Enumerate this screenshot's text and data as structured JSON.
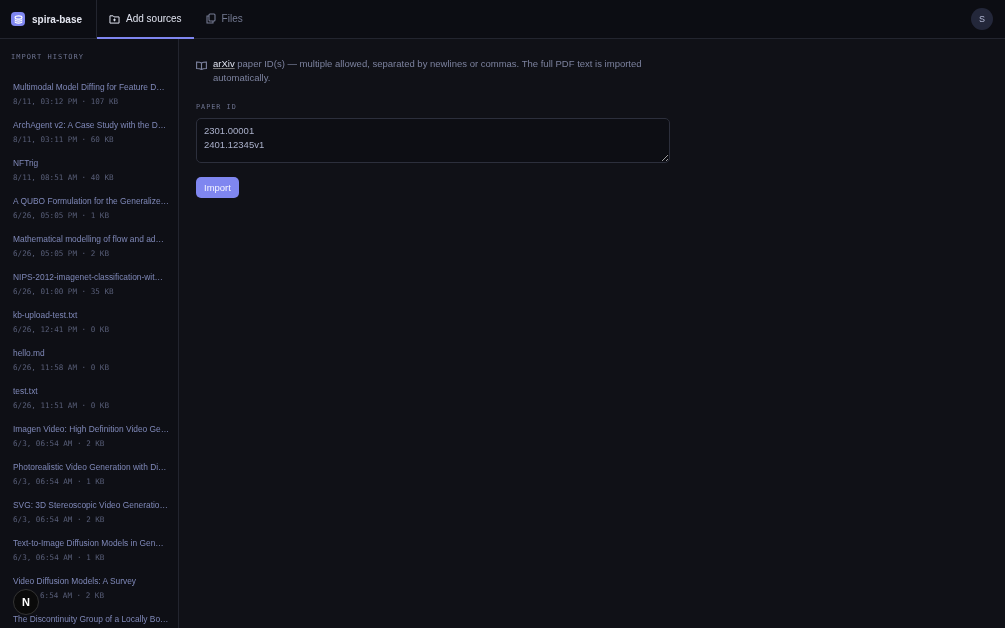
{
  "app": {
    "name": "spira-base",
    "avatar": "S"
  },
  "tabs": [
    {
      "label": "Add sources",
      "selected": true
    },
    {
      "label": "Files",
      "selected": false
    }
  ],
  "sidebar": {
    "heading": "IMPORT HISTORY",
    "items": [
      {
        "title": "Multimodal Model Diffing for Feature D…",
        "meta": "8/11, 03:12 PM · 107 KB"
      },
      {
        "title": "ArchAgent v2: A Case Study with the D…",
        "meta": "8/11, 03:11 PM · 60 KB"
      },
      {
        "title": "NFTrig",
        "meta": "8/11, 08:51 AM · 40 KB"
      },
      {
        "title": "A QUBO Formulation for the Generalize…",
        "meta": "6/26, 05:05 PM · 1 KB"
      },
      {
        "title": "Mathematical modelling of flow and ad…",
        "meta": "6/26, 05:05 PM · 2 KB"
      },
      {
        "title": "NIPS-2012-imagenet-classification-wit…",
        "meta": "6/26, 01:00 PM · 35 KB"
      },
      {
        "title": "kb-upload-test.txt",
        "meta": "6/26, 12:41 PM · 0 KB"
      },
      {
        "title": "hello.md",
        "meta": "6/26, 11:58 AM · 0 KB"
      },
      {
        "title": "test.txt",
        "meta": "6/26, 11:51 AM · 0 KB"
      },
      {
        "title": "Imagen Video: High Definition Video Ge…",
        "meta": "6/3, 06:54 AM · 2 KB"
      },
      {
        "title": "Photorealistic Video Generation with Di…",
        "meta": "6/3, 06:54 AM · 1 KB"
      },
      {
        "title": "SVG: 3D Stereoscopic Video Generatio…",
        "meta": "6/3, 06:54 AM · 2 KB"
      },
      {
        "title": "Text-to-Image Diffusion Models in Gen…",
        "meta": "6/3, 06:54 AM · 1 KB"
      },
      {
        "title": "Video Diffusion Models: A Survey",
        "meta": "6:54 AM · 2 KB",
        "covered_by_badge": true
      },
      {
        "title": "The Discontinuity Group of a Locally Bo…"
      }
    ]
  },
  "source": {
    "link": "arXiv",
    "description": "paper ID(s) — multiple allowed, separated by newlines or commas. The full PDF text is imported automatically.",
    "field_label": "PAPER ID",
    "value": "2301.00001\n2401.12345v1",
    "button": "Import"
  },
  "dev_badge": {
    "label": "N"
  }
}
